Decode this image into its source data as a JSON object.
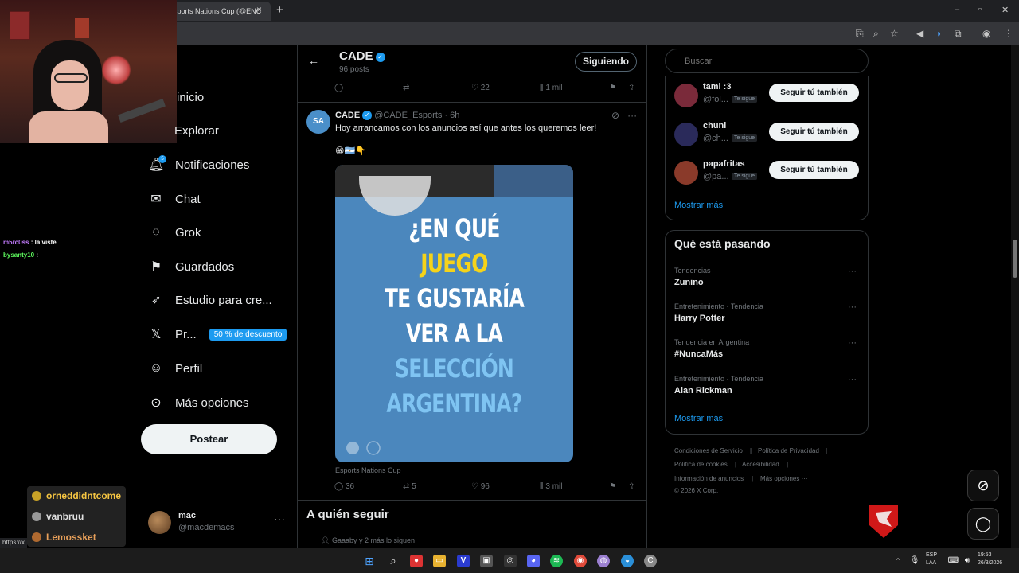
{
  "browser": {
    "tab_title": "sports Nations Cup (@ENC",
    "tab_close": "×",
    "new_tab": "+",
    "url_hint": "https://x",
    "window_buttons": [
      "–",
      "▫",
      "✕"
    ]
  },
  "stream_chat": [
    {
      "user": "m5rc0ss",
      "message": ": la viste"
    },
    {
      "user": "bysanty10",
      "message": ":"
    }
  ],
  "stream_badges": [
    "orneddidntcome",
    "vanbruu",
    "Lemossket"
  ],
  "nav": {
    "items": [
      {
        "label": "Inicio",
        "icon": "home-icon"
      },
      {
        "label": "Explorar",
        "icon": "search-icon"
      },
      {
        "label": "Notificaciones",
        "icon": "bell-icon"
      },
      {
        "label": "Chat",
        "icon": "mail-icon"
      },
      {
        "label": "Grok",
        "icon": "grok-icon"
      },
      {
        "label": "Guardados",
        "icon": "bookmark-icon"
      },
      {
        "label": "Estudio para cre...",
        "icon": "rocket-icon"
      },
      {
        "label": "Pr...",
        "icon": "x-logo-icon"
      },
      {
        "label": "Perfil",
        "icon": "person-icon"
      },
      {
        "label": "Más opciones",
        "icon": "more-circle-icon"
      }
    ],
    "visible_labels": [
      "inicio",
      "Explorar",
      "Notificaciones",
      "Chat",
      "Grok",
      "Guardados",
      "Estudio para cre...",
      "Pr...",
      "Perfil",
      "Más opciones"
    ],
    "notification_count": "5",
    "premium_promo": "50 % de descuento",
    "post_button": "Postear"
  },
  "profile": {
    "name": "mac",
    "handle": "@macdemacs",
    "more": "···"
  },
  "header": {
    "name": "CADE",
    "posts": "96 posts",
    "follow_button": "Siguiendo",
    "back": "←"
  },
  "prev_tweet_actions": {
    "likes": "22",
    "views": "1 mil"
  },
  "tweet": {
    "name": "CADE",
    "handle": "@CADE_Esports",
    "time": "· 6h",
    "text": "Hoy arrancamos con los anuncios así que antes los queremos leer!",
    "emojis": "😁🇦🇷👇",
    "image_lines": [
      "¿EN QUÉ",
      "JUEGO",
      "TE GUSTARÍA",
      "VER A LA",
      "SELECCIÓN",
      "ARGENTINA?"
    ],
    "image_caption": "Esports Nations Cup",
    "replies": "36",
    "retweets": "5",
    "likes": "96",
    "views": "3 mil",
    "avatar_text": "SA"
  },
  "who_to_follow": {
    "title": "A quién seguir",
    "note": "Gaaaby y 2 más lo siguen"
  },
  "search": {
    "placeholder": "Buscar"
  },
  "suggestions": [
    {
      "name": "tami :3",
      "handle": "@fol...",
      "badge": "Te sigue",
      "button": "Seguir tú también",
      "color": "#7a2a3a"
    },
    {
      "name": "chuni",
      "handle": "@ch...",
      "badge": "Te sigue",
      "button": "Seguir tú también",
      "color": "#2a2a5a"
    },
    {
      "name": "papafritas",
      "handle": "@pa...",
      "badge": "Te sigue",
      "button": "Seguir tú también",
      "color": "#8a3a2a"
    }
  ],
  "show_more": "Mostrar más",
  "trends": {
    "title": "Qué está pasando",
    "items": [
      {
        "category": "Tendencias",
        "name": "Zunino"
      },
      {
        "category": "Entretenimiento · Tendencia",
        "name": "Harry Potter"
      },
      {
        "category": "Tendencia en Argentina",
        "name": "#NuncaMás"
      },
      {
        "category": "Entretenimiento · Tendencia",
        "name": "Alan Rickman"
      }
    ],
    "show_more": "Mostrar más",
    "more": "···"
  },
  "footer": {
    "links": [
      "Condiciones de Servicio",
      "Política de Privacidad",
      "Política de cookies",
      "Accesibilidad",
      "Información de anuncios",
      "Más opciones ···"
    ],
    "separator": "|",
    "copyright": "© 2026 X Corp."
  },
  "taskbar": {
    "lang_top": "ESP",
    "lang_bottom": "LAA",
    "time": "19:53",
    "date": "26/3/2026"
  },
  "colors": {
    "accent": "#1d9bf0",
    "image_yellow": "#f5d31a",
    "image_lightblue": "#7fc4f2",
    "image_white": "#ffffff"
  }
}
